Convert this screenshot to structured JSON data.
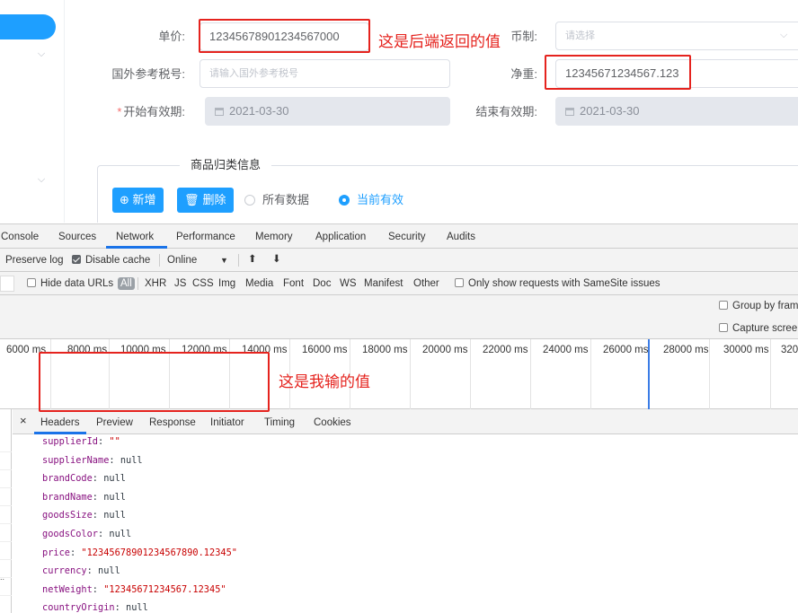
{
  "form": {
    "fields": {
      "unit_price": {
        "label": "单价:",
        "value": "12345678901234567000"
      },
      "currency": {
        "label": "币制:",
        "placeholder": "请选择"
      },
      "foreign_tax_no": {
        "label": "国外参考税号:",
        "placeholder": "请输入国外参考税号"
      },
      "net_weight": {
        "label": "净重:",
        "value": "12345671234567.123"
      },
      "start_date": {
        "required_mark": "*",
        "label": "开始有效期:",
        "value": "2021-03-30"
      },
      "end_date": {
        "label": "结束有效期:",
        "value": "2021-03-30"
      }
    },
    "annotation_backend": "这是后端返回的值",
    "section_title": "商品归类信息",
    "buttons": {
      "add": "⊕ 新增",
      "delete": "删除"
    },
    "radios": {
      "all": "所有数据",
      "current": "当前有效"
    }
  },
  "devtools": {
    "tabs": [
      "Console",
      "Sources",
      "Network",
      "Performance",
      "Memory",
      "Application",
      "Security",
      "Audits"
    ],
    "active_tab": "Network",
    "toolbar1": {
      "preserve_log": "Preserve log",
      "disable_cache": "Disable cache",
      "online": "Online",
      "online_arrow": "▼",
      "upload": "⬆",
      "download": "⬇"
    },
    "toolbar2": {
      "hide_data_urls": "Hide data URLs",
      "all": "All",
      "filters": [
        "XHR",
        "JS",
        "CSS",
        "Img",
        "Media",
        "Font",
        "Doc",
        "WS",
        "Manifest",
        "Other"
      ],
      "samesite": "Only show requests with SameSite issues"
    },
    "options": {
      "group_by_frame": "Group by fram",
      "capture_screenshots": "Capture scree"
    },
    "timeline_labels": [
      "6000 ms",
      "8000 ms",
      "10000 ms",
      "12000 ms",
      "14000 ms",
      "16000 ms",
      "18000 ms",
      "20000 ms",
      "22000 ms",
      "24000 ms",
      "26000 ms",
      "28000 ms",
      "30000 ms",
      "320"
    ],
    "detail_tabs": {
      "close": "×",
      "items": [
        "Headers",
        "Preview",
        "Response",
        "Initiator",
        "Timing",
        "Cookies"
      ],
      "active": "Headers"
    },
    "payload": [
      {
        "key": "supplierId",
        "value": "\"\"",
        "type": "string"
      },
      {
        "key": "supplierName",
        "value": "null",
        "type": "null"
      },
      {
        "key": "brandCode",
        "value": "null",
        "type": "null"
      },
      {
        "key": "brandName",
        "value": "null",
        "type": "null"
      },
      {
        "key": "goodsSize",
        "value": "null",
        "type": "null"
      },
      {
        "key": "goodsColor",
        "value": "null",
        "type": "null"
      },
      {
        "key": "price",
        "value": "\"12345678901234567890.12345\"",
        "type": "string"
      },
      {
        "key": "currency",
        "value": "null",
        "type": "null"
      },
      {
        "key": "netWeight",
        "value": "\"12345671234567.12345\"",
        "type": "string"
      },
      {
        "key": "countryOrigin",
        "value": "null",
        "type": "null"
      }
    ],
    "annotation_input": "这是我输的值",
    "left_ellipsis": ".."
  },
  "colors": {
    "accent": "#1e9fff",
    "highlight": "#e5231e",
    "network_tab_underline": "#1a73e8"
  }
}
